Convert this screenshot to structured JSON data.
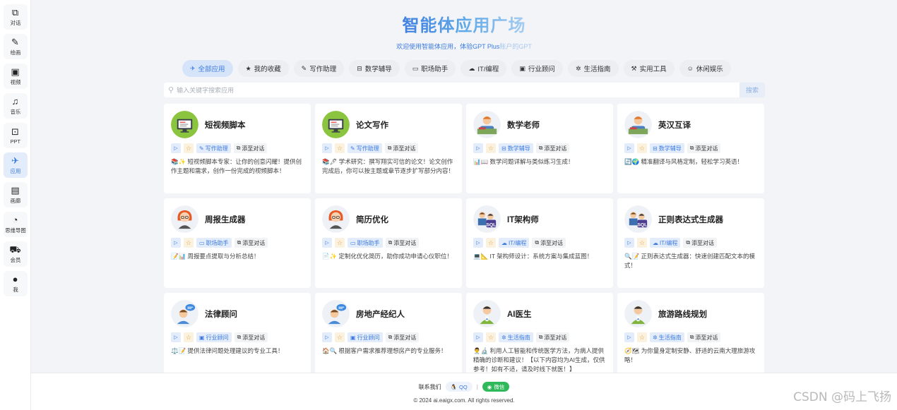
{
  "sidebar": [
    {
      "label": "对话",
      "icon": "chat-icon",
      "glyph": "⧉"
    },
    {
      "label": "绘画",
      "icon": "brush-icon",
      "glyph": "✎"
    },
    {
      "label": "视频",
      "icon": "video-icon",
      "glyph": "▣"
    },
    {
      "label": "音乐",
      "icon": "music-icon",
      "glyph": "♫"
    },
    {
      "label": "PPT",
      "icon": "ppt-icon",
      "glyph": "⊡"
    },
    {
      "label": "应用",
      "icon": "apps-icon",
      "glyph": "✈"
    },
    {
      "label": "画廊",
      "icon": "gallery-icon",
      "glyph": "▤"
    },
    {
      "label": "思维导图",
      "icon": "mindmap-icon",
      "glyph": "◔"
    },
    {
      "label": "会员",
      "icon": "cart-icon",
      "glyph": "⛟"
    },
    {
      "label": "我",
      "icon": "user-icon",
      "glyph": "●"
    }
  ],
  "header": {
    "title": "智能体应用广场",
    "subtitle_main": "欢迎使用智能体应用，体验GPT Plus",
    "subtitle_fade": "账户的GPT"
  },
  "categories": [
    {
      "label": "全部应用",
      "glyph": "✈"
    },
    {
      "label": "我的收藏",
      "glyph": "★"
    },
    {
      "label": "写作助理",
      "glyph": "✎"
    },
    {
      "label": "数学辅导",
      "glyph": "⊟"
    },
    {
      "label": "职场助手",
      "glyph": "▭"
    },
    {
      "label": "IT/编程",
      "glyph": "☁"
    },
    {
      "label": "行业顾问",
      "glyph": "▣"
    },
    {
      "label": "生活指南",
      "glyph": "✲"
    },
    {
      "label": "实用工具",
      "glyph": "⚒"
    },
    {
      "label": "休闲娱乐",
      "glyph": "☺"
    }
  ],
  "search": {
    "placeholder": "输入关键字搜索应用",
    "button": "搜索"
  },
  "card_common": {
    "add_label": "添至对话"
  },
  "cards": [
    {
      "title": "短视频脚本",
      "tag": "写作助理",
      "tag_glyph": "✎",
      "avatar": "monitor",
      "desc": "📚✨ 短视频脚本专家：让你的创意闪耀！提供创作主题和需求，创作一份完成的视频脚本！"
    },
    {
      "title": "论文写作",
      "tag": "写作助理",
      "tag_glyph": "✎",
      "avatar": "monitor",
      "desc": "📚🖊 学术研究：撰写翔实可信的论文！论文创作完成后，你可以按主题或章节逐步扩写部分内容！"
    },
    {
      "title": "数学老师",
      "tag": "数学辅导",
      "tag_glyph": "⊟",
      "avatar": "teacher",
      "desc": "📊📖 数学问题详解与类似练习生成！"
    },
    {
      "title": "英汉互译",
      "tag": "数学辅导",
      "tag_glyph": "⊟",
      "avatar": "teacher",
      "desc": "🔄🌍 精准翻译与风格定制，轻松学习英语！"
    },
    {
      "title": "周报生成器",
      "tag": "职场助手",
      "tag_glyph": "▭",
      "avatar": "redhair",
      "desc": "📝📊 周报要点提取与分析总结！"
    },
    {
      "title": "简历优化",
      "tag": "职场助手",
      "tag_glyph": "▭",
      "avatar": "redhair",
      "desc": "📄✨ 定制化优化简历，助你成功申请心仪职位！"
    },
    {
      "title": "IT架构师",
      "tag": "IT/编程",
      "tag_glyph": "☁",
      "avatar": "sql",
      "desc": "💻📐 IT 架构师设计：系统方案与集成蓝图！"
    },
    {
      "title": "正则表达式生成器",
      "tag": "IT/编程",
      "tag_glyph": "☁",
      "avatar": "sql",
      "desc": "🔍📝 正则表达式生成器：快速创建匹配文本的模式！"
    },
    {
      "title": "法律顾问",
      "tag": "行业顾问",
      "tag_glyph": "▣",
      "avatar": "chat",
      "desc": "⚖️📝 提供法律问题处理建议的专业工具！"
    },
    {
      "title": "房地产经纪人",
      "tag": "行业顾问",
      "tag_glyph": "▣",
      "avatar": "chat",
      "desc": "🏠🔍 根据客户需求推荐理想房产的专业服务！"
    },
    {
      "title": "AI医生",
      "tag": "生活指南",
      "tag_glyph": "✲",
      "avatar": "green",
      "desc": "👨‍⚕️🔬 利用人工智能和传统医学方法，为病人提供精确的诊断和建议！【以下内容均为AI生成，仅供参考！如有不适，请及时线下就医！】"
    },
    {
      "title": "旅游路线规划",
      "tag": "生活指南",
      "tag_glyph": "✲",
      "avatar": "green",
      "desc": "🧭🗺 为你量身定制安静、舒适的云南大理旅游攻略！"
    }
  ],
  "footer": {
    "contact_label": "联系我们",
    "qq_label": "QQ",
    "separator": "|",
    "wechat_label": "微信",
    "copyright": "© 2024 ai.eaigx.com. All rights reserved."
  },
  "watermark": "CSDN @码上飞扬",
  "colors": {
    "accent": "#3d7be0",
    "page_bg": "#f2f4f8",
    "wechat": "#2fb95a",
    "star": "#e6a23c"
  }
}
